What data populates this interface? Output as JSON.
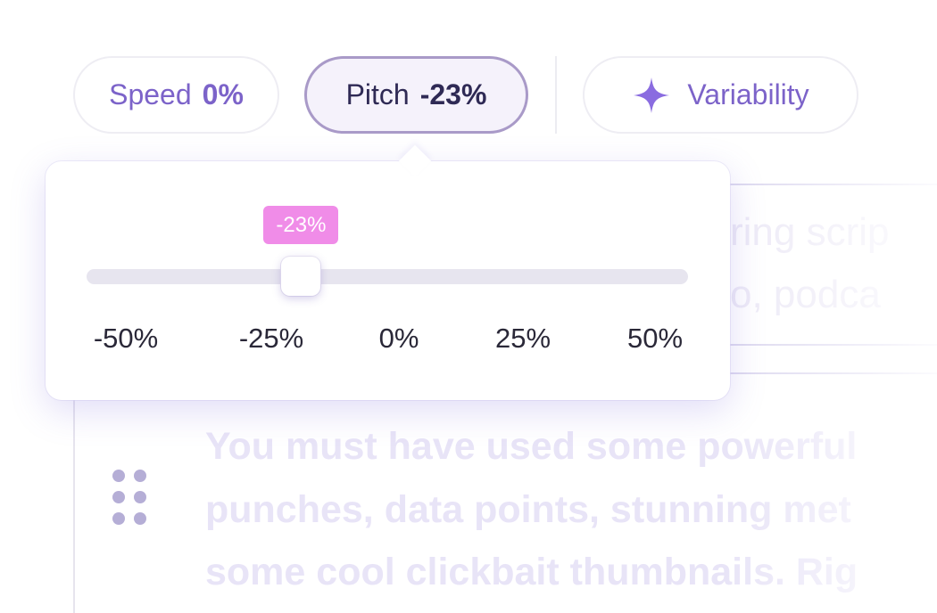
{
  "toolbar": {
    "speed": {
      "label": "Speed",
      "value": "0%"
    },
    "pitch": {
      "label": "Pitch",
      "value": "-23%"
    },
    "variability": {
      "label": "Variability",
      "icon": "sparkle-icon"
    }
  },
  "pitch_slider": {
    "value_label": "-23%",
    "value": -23,
    "min": -50,
    "max": 50,
    "ticks": [
      "-50%",
      "-25%",
      "0%",
      "25%",
      "50%"
    ]
  },
  "background": {
    "block1_line1": "ring scrip",
    "block1_line2": "o, podca",
    "block2_line1": "You must have used some powerful",
    "block2_line2": "punches, data points, stunning met",
    "block2_line3": "some cool clickbait thumbnails. Rig"
  },
  "colors": {
    "accent": "#7c63c9",
    "pitch_active_border": "#a99ac8",
    "value_tag": "#f08ce8",
    "track": "#e7e5ef"
  }
}
